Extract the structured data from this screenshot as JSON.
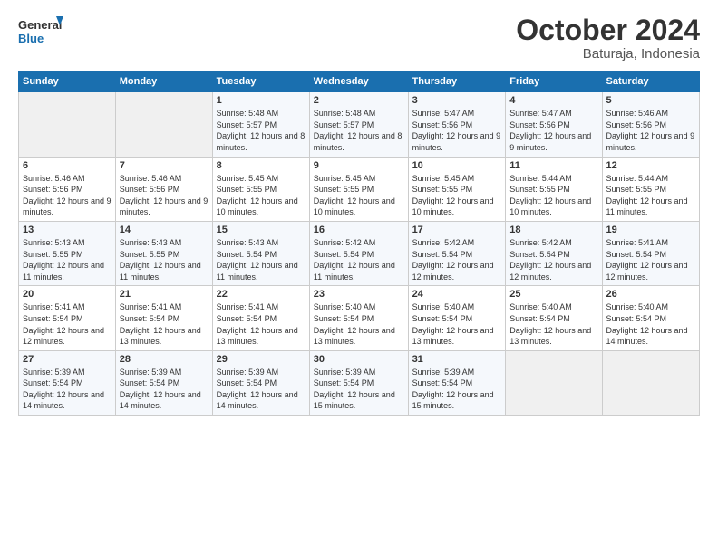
{
  "logo": {
    "line1": "General",
    "line2": "Blue"
  },
  "title": "October 2024",
  "location": "Baturaja, Indonesia",
  "days_header": [
    "Sunday",
    "Monday",
    "Tuesday",
    "Wednesday",
    "Thursday",
    "Friday",
    "Saturday"
  ],
  "weeks": [
    [
      {
        "day": "",
        "info": ""
      },
      {
        "day": "",
        "info": ""
      },
      {
        "day": "1",
        "sunrise": "5:48 AM",
        "sunset": "5:57 PM",
        "daylight": "12 hours and 8 minutes."
      },
      {
        "day": "2",
        "sunrise": "5:48 AM",
        "sunset": "5:57 PM",
        "daylight": "12 hours and 8 minutes."
      },
      {
        "day": "3",
        "sunrise": "5:47 AM",
        "sunset": "5:56 PM",
        "daylight": "12 hours and 9 minutes."
      },
      {
        "day": "4",
        "sunrise": "5:47 AM",
        "sunset": "5:56 PM",
        "daylight": "12 hours and 9 minutes."
      },
      {
        "day": "5",
        "sunrise": "5:46 AM",
        "sunset": "5:56 PM",
        "daylight": "12 hours and 9 minutes."
      }
    ],
    [
      {
        "day": "6",
        "sunrise": "5:46 AM",
        "sunset": "5:56 PM",
        "daylight": "12 hours and 9 minutes."
      },
      {
        "day": "7",
        "sunrise": "5:46 AM",
        "sunset": "5:56 PM",
        "daylight": "12 hours and 9 minutes."
      },
      {
        "day": "8",
        "sunrise": "5:45 AM",
        "sunset": "5:55 PM",
        "daylight": "12 hours and 10 minutes."
      },
      {
        "day": "9",
        "sunrise": "5:45 AM",
        "sunset": "5:55 PM",
        "daylight": "12 hours and 10 minutes."
      },
      {
        "day": "10",
        "sunrise": "5:45 AM",
        "sunset": "5:55 PM",
        "daylight": "12 hours and 10 minutes."
      },
      {
        "day": "11",
        "sunrise": "5:44 AM",
        "sunset": "5:55 PM",
        "daylight": "12 hours and 10 minutes."
      },
      {
        "day": "12",
        "sunrise": "5:44 AM",
        "sunset": "5:55 PM",
        "daylight": "12 hours and 11 minutes."
      }
    ],
    [
      {
        "day": "13",
        "sunrise": "5:43 AM",
        "sunset": "5:55 PM",
        "daylight": "12 hours and 11 minutes."
      },
      {
        "day": "14",
        "sunrise": "5:43 AM",
        "sunset": "5:55 PM",
        "daylight": "12 hours and 11 minutes."
      },
      {
        "day": "15",
        "sunrise": "5:43 AM",
        "sunset": "5:54 PM",
        "daylight": "12 hours and 11 minutes."
      },
      {
        "day": "16",
        "sunrise": "5:42 AM",
        "sunset": "5:54 PM",
        "daylight": "12 hours and 11 minutes."
      },
      {
        "day": "17",
        "sunrise": "5:42 AM",
        "sunset": "5:54 PM",
        "daylight": "12 hours and 12 minutes."
      },
      {
        "day": "18",
        "sunrise": "5:42 AM",
        "sunset": "5:54 PM",
        "daylight": "12 hours and 12 minutes."
      },
      {
        "day": "19",
        "sunrise": "5:41 AM",
        "sunset": "5:54 PM",
        "daylight": "12 hours and 12 minutes."
      }
    ],
    [
      {
        "day": "20",
        "sunrise": "5:41 AM",
        "sunset": "5:54 PM",
        "daylight": "12 hours and 12 minutes."
      },
      {
        "day": "21",
        "sunrise": "5:41 AM",
        "sunset": "5:54 PM",
        "daylight": "12 hours and 13 minutes."
      },
      {
        "day": "22",
        "sunrise": "5:41 AM",
        "sunset": "5:54 PM",
        "daylight": "12 hours and 13 minutes."
      },
      {
        "day": "23",
        "sunrise": "5:40 AM",
        "sunset": "5:54 PM",
        "daylight": "12 hours and 13 minutes."
      },
      {
        "day": "24",
        "sunrise": "5:40 AM",
        "sunset": "5:54 PM",
        "daylight": "12 hours and 13 minutes."
      },
      {
        "day": "25",
        "sunrise": "5:40 AM",
        "sunset": "5:54 PM",
        "daylight": "12 hours and 13 minutes."
      },
      {
        "day": "26",
        "sunrise": "5:40 AM",
        "sunset": "5:54 PM",
        "daylight": "12 hours and 14 minutes."
      }
    ],
    [
      {
        "day": "27",
        "sunrise": "5:39 AM",
        "sunset": "5:54 PM",
        "daylight": "12 hours and 14 minutes."
      },
      {
        "day": "28",
        "sunrise": "5:39 AM",
        "sunset": "5:54 PM",
        "daylight": "12 hours and 14 minutes."
      },
      {
        "day": "29",
        "sunrise": "5:39 AM",
        "sunset": "5:54 PM",
        "daylight": "12 hours and 14 minutes."
      },
      {
        "day": "30",
        "sunrise": "5:39 AM",
        "sunset": "5:54 PM",
        "daylight": "12 hours and 15 minutes."
      },
      {
        "day": "31",
        "sunrise": "5:39 AM",
        "sunset": "5:54 PM",
        "daylight": "12 hours and 15 minutes."
      },
      {
        "day": "",
        "info": ""
      },
      {
        "day": "",
        "info": ""
      }
    ]
  ],
  "labels": {
    "sunrise": "Sunrise:",
    "sunset": "Sunset:",
    "daylight": "Daylight:"
  }
}
